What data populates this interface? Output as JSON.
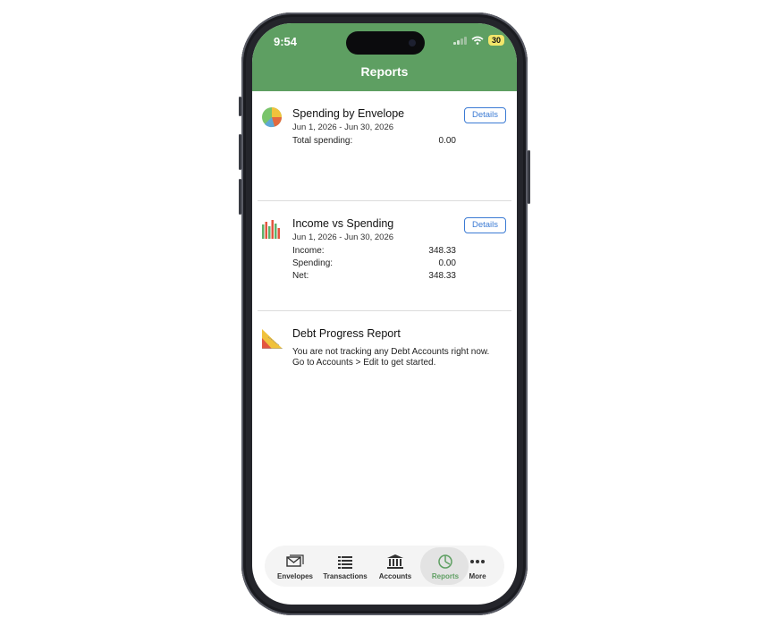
{
  "status": {
    "time": "9:54",
    "battery": "30"
  },
  "header": {
    "title": "Reports"
  },
  "reports": {
    "spending_by_envelope": {
      "title": "Spending by Envelope",
      "date_range": "Jun 1, 2026 - Jun 30, 2026",
      "details_label": "Details",
      "rows": [
        {
          "label": "Total spending:",
          "value": "0.00"
        }
      ]
    },
    "income_vs_spending": {
      "title": "Income vs Spending",
      "date_range": "Jun 1, 2026 - Jun 30, 2026",
      "details_label": "Details",
      "rows": [
        {
          "label": "Income:",
          "value": "348.33"
        },
        {
          "label": "Spending:",
          "value": "0.00"
        },
        {
          "label": "Net:",
          "value": "348.33"
        }
      ]
    },
    "debt_progress": {
      "title": "Debt Progress Report",
      "message_line1": "You are not tracking any Debt Accounts right now.",
      "message_line2": "Go to Accounts > Edit to get started."
    }
  },
  "tabs": [
    {
      "label": "Envelopes",
      "icon": "envelopes-icon"
    },
    {
      "label": "Transactions",
      "icon": "list-icon"
    },
    {
      "label": "Accounts",
      "icon": "bank-icon"
    },
    {
      "label": "Reports",
      "icon": "pie-chart-icon",
      "active": true
    },
    {
      "label": "More",
      "icon": "ellipsis-icon"
    }
  ],
  "colors": {
    "header_green": "#5e9f62",
    "link_blue": "#3c7bd4",
    "active_tab": "#5e9f62"
  }
}
